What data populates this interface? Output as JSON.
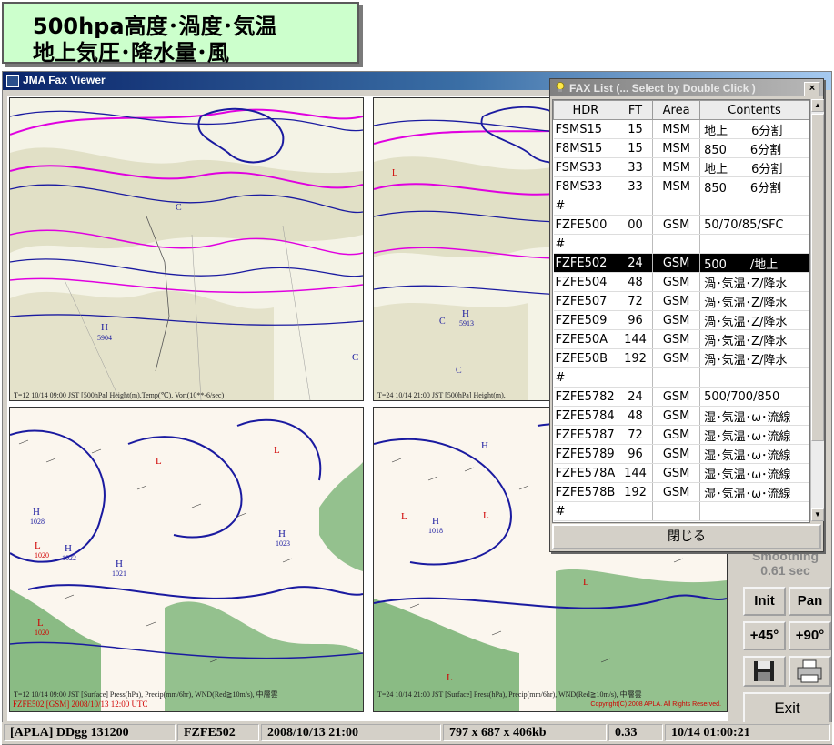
{
  "banner": {
    "line1": "500hpa高度･渦度･気温",
    "line2": "地上気圧･降水量･風"
  },
  "window": {
    "title": "JMA Fax Viewer"
  },
  "panels": {
    "top_left_caption": "T=12   10/14  09:00 JST        [500hPa]   Height(m),Temp(℃),  Vort(10**-6/sec)",
    "top_right_caption": "T=24   10/14  21:00 JST       [500hPa]   Height(m),",
    "bottom_left_caption": "T=12   10/14  09:00 JST       [Surface]   Press(hPa),  Precip(mm/6hr),  WND(Red≧10m/s),  中層雲",
    "bottom_right_caption": "T=24   10/14  21:00 JST       [Surface]   Press(hPa),  Precip(mm/6hr),  WND(Red≧10m/s),  中層雲",
    "bottom_label": "FZFE502  [GSM]  2008/10/13  12:00 UTC",
    "copyright": "Copyright(C) 2008 APLA. All Rights Reserved."
  },
  "controls": {
    "smoothing_label": "Smoothing",
    "smoothing_value": "0.61 sec",
    "init": "Init",
    "pan": "Pan",
    "rotate_left": "+45°",
    "rotate_right": "+90°",
    "exit": "Exit"
  },
  "status": {
    "app": "[APLA] DDgg 131200",
    "file": "FZFE502",
    "issued": "2008/10/13 21:00",
    "size": "797 x 687 x 406kb",
    "ratio": "0.33",
    "clock": "10/14 01:00:21"
  },
  "faxlist": {
    "title": "FAX List (... Select by Double Click )",
    "close_x": "×",
    "columns": [
      "HDR",
      "FT",
      "Area",
      "Contents"
    ],
    "rows": [
      {
        "hdr": "FSMS15",
        "ft": "15",
        "area": "MSM",
        "contents": "地上　　6分割"
      },
      {
        "hdr": "F8MS15",
        "ft": "15",
        "area": "MSM",
        "contents": "850　　6分割"
      },
      {
        "hdr": "FSMS33",
        "ft": "33",
        "area": "MSM",
        "contents": "地上　　6分割"
      },
      {
        "hdr": "F8MS33",
        "ft": "33",
        "area": "MSM",
        "contents": "850　　6分割"
      },
      {
        "hdr": "#",
        "ft": "",
        "area": "",
        "contents": ""
      },
      {
        "hdr": "FZFE500",
        "ft": "00",
        "area": "GSM",
        "contents": "50/70/85/SFC"
      },
      {
        "hdr": "#",
        "ft": "",
        "area": "",
        "contents": ""
      },
      {
        "hdr": "FZFE502",
        "ft": "24",
        "area": "GSM",
        "contents": "500　　/地上",
        "selected": true
      },
      {
        "hdr": "FZFE504",
        "ft": "48",
        "area": "GSM",
        "contents": "渦･気温･Z/降水"
      },
      {
        "hdr": "FZFE507",
        "ft": "72",
        "area": "GSM",
        "contents": "渦･気温･Z/降水"
      },
      {
        "hdr": "FZFE509",
        "ft": "96",
        "area": "GSM",
        "contents": "渦･気温･Z/降水"
      },
      {
        "hdr": "FZFE50A",
        "ft": "144",
        "area": "GSM",
        "contents": "渦･気温･Z/降水"
      },
      {
        "hdr": "FZFE50B",
        "ft": "192",
        "area": "GSM",
        "contents": "渦･気温･Z/降水"
      },
      {
        "hdr": "#",
        "ft": "",
        "area": "",
        "contents": ""
      },
      {
        "hdr": "FZFE5782",
        "ft": "24",
        "area": "GSM",
        "contents": "500/700/850"
      },
      {
        "hdr": "FZFE5784",
        "ft": "48",
        "area": "GSM",
        "contents": "湿･気温･ω･流線"
      },
      {
        "hdr": "FZFE5787",
        "ft": "72",
        "area": "GSM",
        "contents": "湿･気温･ω･流線"
      },
      {
        "hdr": "FZFE5789",
        "ft": "96",
        "area": "GSM",
        "contents": "湿･気温･ω･流線"
      },
      {
        "hdr": "FZFE578A",
        "ft": "144",
        "area": "GSM",
        "contents": "湿･気温･ω･流線"
      },
      {
        "hdr": "FZFE578B",
        "ft": "192",
        "area": "GSM",
        "contents": "湿･気温･ω･流線"
      },
      {
        "hdr": "#",
        "ft": "",
        "area": "",
        "contents": ""
      }
    ],
    "close_button": "閉じる"
  }
}
